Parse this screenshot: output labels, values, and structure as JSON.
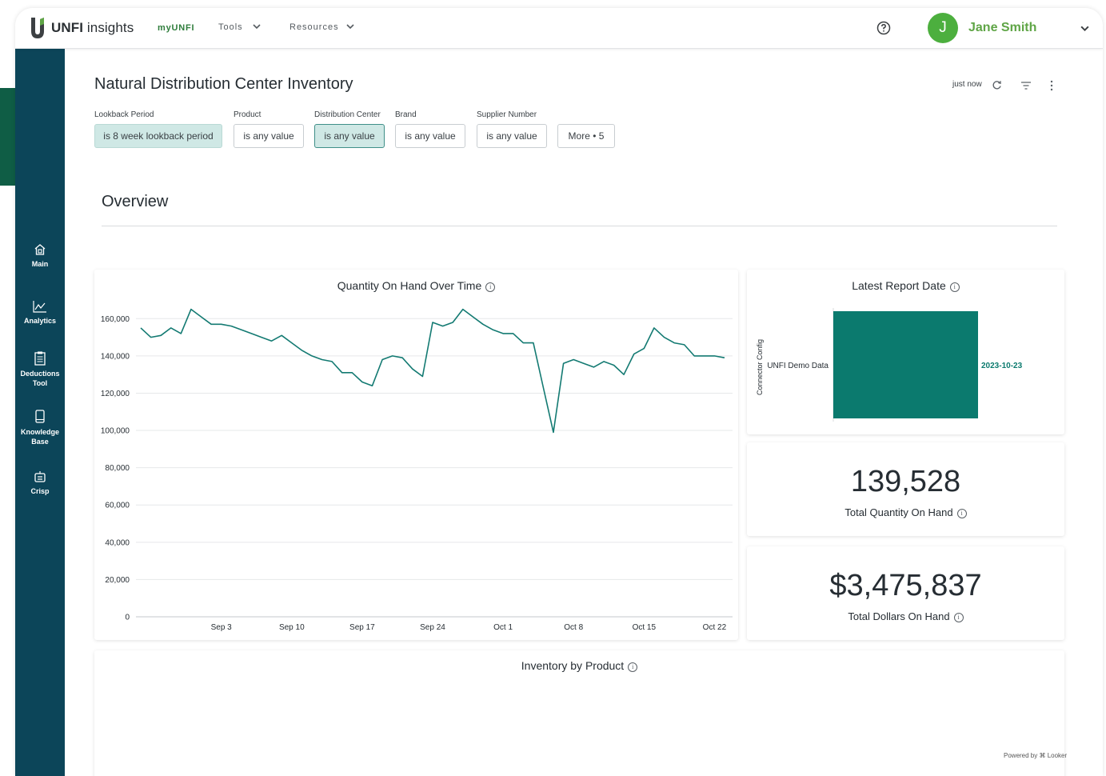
{
  "header": {
    "brand_bold": "UNFI",
    "brand_light": "insights",
    "nav": {
      "myunfi": "myUNFI",
      "tools": "Tools",
      "resources": "Resources"
    },
    "user": {
      "initial": "J",
      "name": "Jane Smith"
    },
    "colors": {
      "brand_green": "#2f7d3c",
      "avatar": "#4caf3e"
    }
  },
  "sidebar": {
    "items": [
      {
        "label_1": "Main",
        "label_2": "",
        "icon": "home-icon"
      },
      {
        "label_1": "Analytics",
        "label_2": "",
        "icon": "analytics-icon"
      },
      {
        "label_1": "Deductions",
        "label_2": "Tool",
        "icon": "document-icon"
      },
      {
        "label_1": "Knowledge",
        "label_2": "Base",
        "icon": "tablet-icon"
      },
      {
        "label_1": "Crisp",
        "label_2": "",
        "icon": "crisp-icon"
      }
    ],
    "color": "#0c4559"
  },
  "dashboard": {
    "title": "Natural Distribution Center Inventory",
    "last_updated": "just now",
    "filters": [
      {
        "label": "Lookback Period",
        "value": "is 8 week lookback period"
      },
      {
        "label": "Product",
        "value": "is any value"
      },
      {
        "label": "Distribution Center",
        "value": "is any value"
      },
      {
        "label": "Brand",
        "value": "is any value"
      },
      {
        "label": "Supplier Number",
        "value": "is any value"
      }
    ],
    "more_filters": "More • 5",
    "overview_title": "Overview",
    "powered_by": "Powered by ⌘ Looker"
  },
  "cards": {
    "qoh_title": "Quantity On Hand Over Time",
    "latest_title": "Latest Report Date",
    "latest_axis_label": "Connector Config",
    "latest_category": "UNFI Demo Data",
    "latest_value": "2023-10-23",
    "total_qty": "139,528",
    "total_qty_label": "Total Quantity On Hand",
    "total_dollars": "$3,475,837",
    "total_dollars_label": "Total Dollars On Hand",
    "inventory_title": "Inventory by Product"
  },
  "chart_data": [
    {
      "type": "line",
      "title": "Quantity On Hand Over Time",
      "color": "#137a72",
      "ylim": [
        0,
        170000
      ],
      "yticks": [
        0,
        20000,
        40000,
        60000,
        80000,
        100000,
        120000,
        140000,
        160000
      ],
      "ytick_labels": [
        "0",
        "20,000",
        "40,000",
        "60,000",
        "80,000",
        "100,000",
        "120,000",
        "140,000",
        "160,000"
      ],
      "xtick_labels": [
        "Sep 3",
        "Sep 10",
        "Sep 17",
        "Sep 24",
        "Oct 1",
        "Oct 8",
        "Oct 15",
        "Oct 22"
      ],
      "xtick_days": [
        8,
        15,
        22,
        29,
        36,
        43,
        50,
        57
      ],
      "x_days": [
        0,
        1,
        2,
        3,
        4,
        5,
        6,
        7,
        8,
        9,
        10,
        11,
        12,
        13,
        14,
        15,
        16,
        17,
        18,
        19,
        20,
        21,
        22,
        23,
        24,
        25,
        26,
        27,
        28,
        29,
        30,
        31,
        32,
        33,
        34,
        35,
        36,
        37,
        38,
        39,
        40,
        41,
        42,
        43,
        44,
        45,
        46,
        47,
        48,
        49,
        50,
        51,
        52,
        53,
        54,
        55,
        56,
        57,
        58
      ],
      "x_dates": [
        "Aug 26",
        "Aug 27",
        "Aug 28",
        "Aug 29",
        "Aug 30",
        "Aug 31",
        "Sep 1",
        "Sep 2",
        "Sep 3",
        "Sep 4",
        "Sep 5",
        "Sep 6",
        "Sep 7",
        "Sep 8",
        "Sep 9",
        "Sep 10",
        "Sep 11",
        "Sep 12",
        "Sep 13",
        "Sep 14",
        "Sep 15",
        "Sep 16",
        "Sep 17",
        "Sep 18",
        "Sep 19",
        "Sep 20",
        "Sep 21",
        "Sep 22",
        "Sep 23",
        "Sep 24",
        "Sep 25",
        "Sep 26",
        "Sep 27",
        "Sep 28",
        "Sep 29",
        "Sep 30",
        "Oct 1",
        "Oct 2",
        "Oct 3",
        "Oct 4",
        "Oct 5",
        "Oct 6",
        "Oct 7",
        "Oct 8",
        "Oct 9",
        "Oct 10",
        "Oct 11",
        "Oct 12",
        "Oct 13",
        "Oct 14",
        "Oct 15",
        "Oct 16",
        "Oct 17",
        "Oct 18",
        "Oct 19",
        "Oct 20",
        "Oct 21",
        "Oct 22",
        "Oct 23"
      ],
      "values": [
        155000,
        150000,
        151000,
        155000,
        152000,
        165000,
        161000,
        157000,
        157000,
        156000,
        154000,
        152000,
        150000,
        148000,
        151000,
        147000,
        143000,
        140000,
        138000,
        137000,
        131000,
        131000,
        126000,
        124000,
        138000,
        140000,
        139000,
        133000,
        129000,
        158000,
        156000,
        158000,
        165000,
        161000,
        157000,
        154000,
        152000,
        152000,
        147000,
        147000,
        123000,
        99000,
        136000,
        138000,
        136000,
        134000,
        137000,
        135000,
        130000,
        141000,
        144000,
        155000,
        150000,
        147000,
        146000,
        140000,
        140000,
        140000,
        139000
      ]
    },
    {
      "type": "bar",
      "orientation": "horizontal",
      "title": "Latest Report Date",
      "ylabel": "Connector Config",
      "categories": [
        "UNFI Demo Data"
      ],
      "value_labels": [
        "2023-10-23"
      ],
      "color": "#0b7a6e"
    }
  ]
}
